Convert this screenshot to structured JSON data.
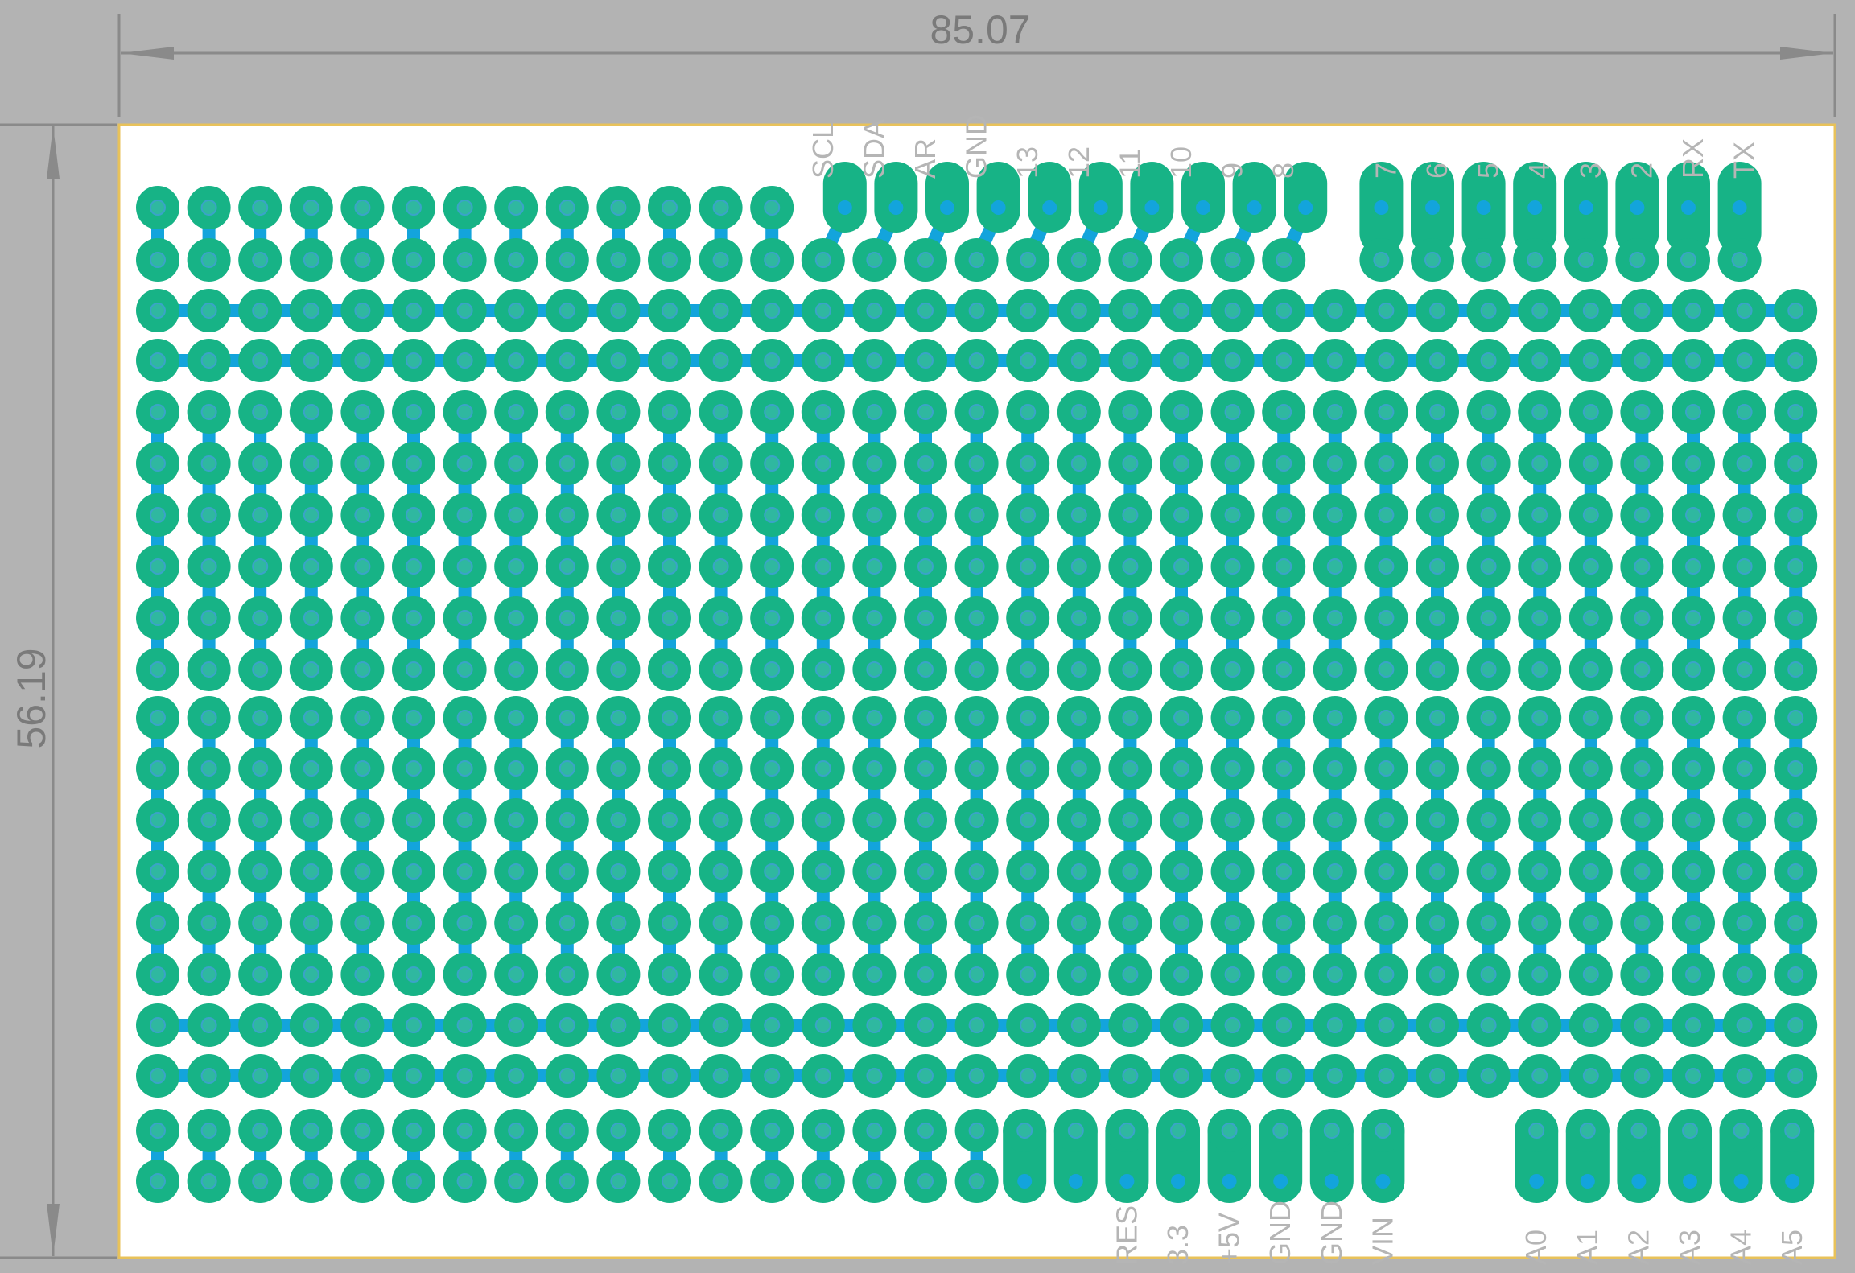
{
  "dimensions": {
    "width_label": "85.07",
    "height_label": "56.19"
  },
  "top_header_labels": [
    "SCL",
    "SDA",
    "AR",
    "GND",
    "13",
    "12",
    "11",
    "10",
    "9",
    "8",
    "7",
    "6",
    "5",
    "4",
    "3",
    "2",
    "RX",
    "TX"
  ],
  "bottom_header_labels": [
    "RES",
    "3.3",
    "+5V",
    "GND",
    "GND",
    "VIN",
    "A0",
    "A1",
    "A2",
    "A3",
    "A4",
    "A5"
  ],
  "colors": {
    "background": "#b3b3b3",
    "board": "#ffffff",
    "board_outline": "#e8c25a",
    "pad": "#17b386",
    "trace": "#13a4dc",
    "drill": "#2fb8a0",
    "dimension_line": "#8a8a8a",
    "silkscreen": "#b5b5b5"
  }
}
